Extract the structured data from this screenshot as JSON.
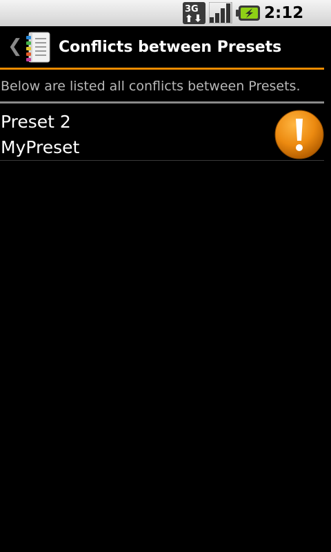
{
  "status_bar": {
    "network": "3G",
    "time": "2:12 PM",
    "icons": [
      "3g-data-icon",
      "signal-strength-icon",
      "battery-charging-icon"
    ]
  },
  "header": {
    "back_glyph": "❮",
    "title": "Conflicts between Presets",
    "icon": "notebook-icon"
  },
  "main": {
    "description": "Below are listed all conflicts between Presets.",
    "conflicts": [
      {
        "line1": "Preset 2",
        "line2": "MyPreset",
        "icon": "warning-icon"
      }
    ]
  },
  "colors": {
    "accent": "#f08c00",
    "divider": "#8a8a8a",
    "background": "#000000",
    "warning": "#e88a0c"
  }
}
